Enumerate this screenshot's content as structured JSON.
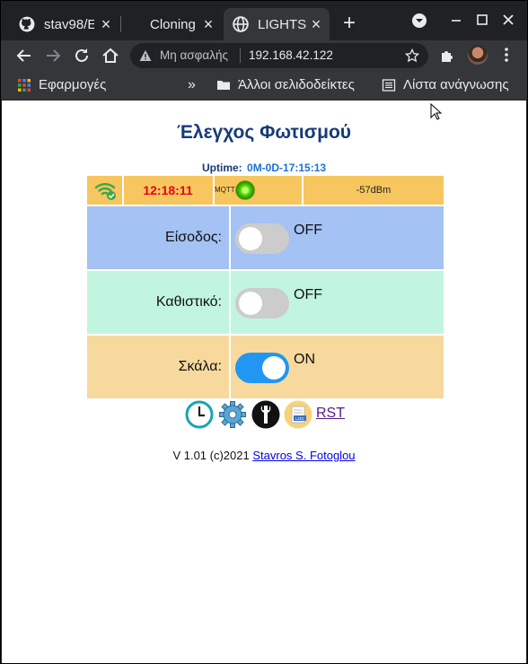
{
  "browser": {
    "tabs": [
      {
        "title": "stav98/E",
        "icon": "github-icon"
      },
      {
        "title": "Cloning",
        "icon": ""
      },
      {
        "title": "LIGHTS",
        "icon": "globe-icon",
        "active": true
      }
    ],
    "address": {
      "security_label": "Μη ασφαλής",
      "url": "192.168.42.122"
    },
    "bookmarks": {
      "apps": "Εφαρμογές",
      "more": "»",
      "other": "Άλλοι σελιδοδείκτες",
      "reading_list": "Λίστα ανάγνωσης"
    }
  },
  "page": {
    "title": "Έλεγχος Φωτισμού",
    "uptime_label": "Uptime:",
    "uptime_value": "0M-0D-17:15:13",
    "status": {
      "time": "12:18:11",
      "mqtt_label": "MQTT",
      "rssi": "-57dBm",
      "mqtt_connected": true
    },
    "lights": [
      {
        "label": "Είσοδος:",
        "state": "OFF",
        "on": false,
        "bg": "#a4c2f4"
      },
      {
        "label": "Καθιστικό:",
        "state": "OFF",
        "on": false,
        "bg": "#c2f5df"
      },
      {
        "label": "Σκάλα:",
        "state": "ON",
        "on": true,
        "bg": "#f7d99d"
      }
    ],
    "icons": [
      "clock-icon",
      "gear-icon",
      "wrench-icon",
      "log-icon"
    ],
    "rst_label": "RST",
    "footer_prefix": "V 1.01 (c)2021",
    "footer_author": "Stavros S. Fotoglou"
  }
}
